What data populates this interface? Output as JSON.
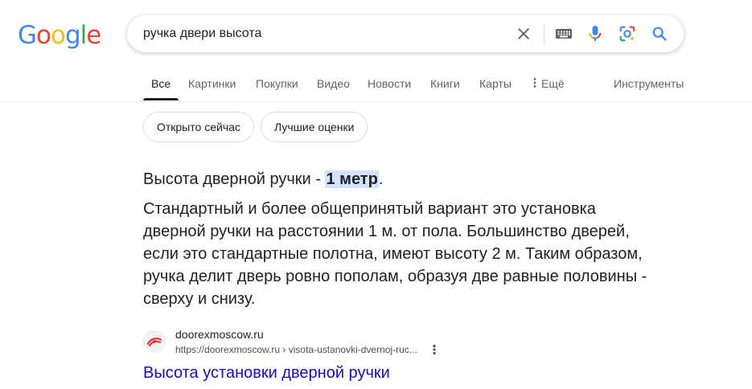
{
  "logo": {
    "letters": [
      "G",
      "o",
      "o",
      "g",
      "l",
      "e"
    ],
    "colors": [
      "#4285F4",
      "#EA4335",
      "#FBBC05",
      "#4285F4",
      "#34A853",
      "#EA4335"
    ]
  },
  "search": {
    "query": "ручка двери высота"
  },
  "tabs": [
    {
      "label": "Все",
      "active": true
    },
    {
      "label": "Картинки"
    },
    {
      "label": "Покупки"
    },
    {
      "label": "Видео"
    },
    {
      "label": "Новости"
    },
    {
      "label": "Книги"
    },
    {
      "label": "Карты"
    },
    {
      "label": "Ещё"
    }
  ],
  "tools_label": "Инструменты",
  "chips": [
    "Открыто сейчас",
    "Лучшие оценки"
  ],
  "featured": {
    "answer_prefix": "Высота дверной ручки - ",
    "answer_highlight": "1 метр",
    "answer_suffix": ".",
    "snippet": "Стандартный и более общепринятый вариант это установка дверной ручки на расстоянии 1 м. от пола. Большинство дверей, если это стандартные полотна, имеют высоту 2 м. Таким образом, ручка делит дверь ровно пополам, образуя две равные половины - сверху и снизу."
  },
  "source": {
    "site_name": "doorexmoscow.ru",
    "url": "https://doorexmoscow.ru › visota-ustanovki-dvernoj-ruc...",
    "title": "Высота установки дверной ручки"
  },
  "colors": {
    "accent_blue": "#4285F4",
    "link": "#1a0dab",
    "highlight": "#d3e3fd",
    "favicon_red": "#e53935"
  }
}
